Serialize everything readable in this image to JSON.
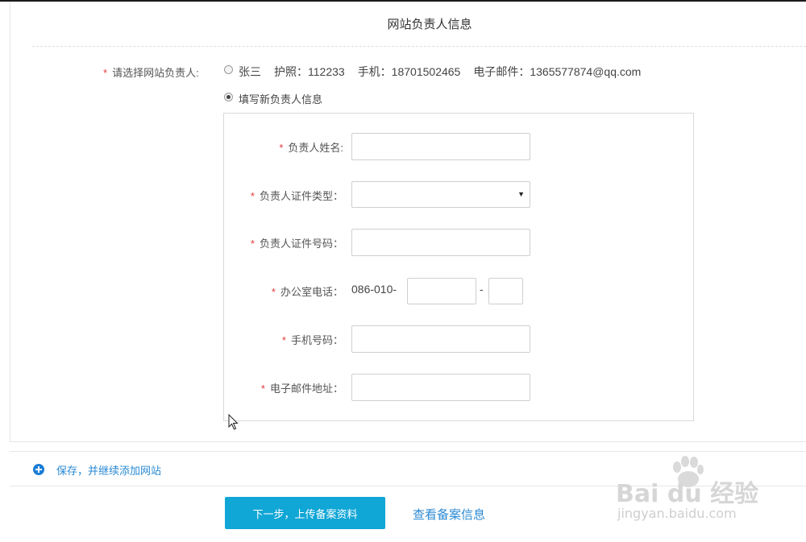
{
  "section": {
    "title": "网站负责人信息"
  },
  "selector": {
    "label": "请选择网站负责人:",
    "existing": {
      "name": "张三",
      "passport": "护照：112233",
      "phone": "手机：18701502465",
      "email": "电子邮件：1365577874@qq.com",
      "selected": false
    },
    "new_option": {
      "label": "填写新负责人信息",
      "selected": true
    }
  },
  "form": {
    "name": {
      "label": "负责人姓名:",
      "value": ""
    },
    "id_type": {
      "label": "负责人证件类型：",
      "value": ""
    },
    "id_number": {
      "label": "负责人证件号码：",
      "value": ""
    },
    "office_phone": {
      "label": "办公室电话：",
      "prefix": "086-010-",
      "separator": "-",
      "number": "",
      "extension": ""
    },
    "mobile": {
      "label": "手机号码：",
      "value": ""
    },
    "email": {
      "label": "电子邮件地址：",
      "value": ""
    }
  },
  "actions": {
    "save_continue": "保存，并继续添加网站",
    "next": "下一步，上传备案资料",
    "view_info": "查看备案信息"
  },
  "icons": {
    "add": "plus-circle-icon",
    "cursor": "mouse-cursor-icon"
  },
  "colors": {
    "required": "#e4393c",
    "primary_button": "#10a6d6",
    "link": "#2a8ad4"
  },
  "watermark": {
    "brand": "Bai du 经验",
    "url": "jingyan.baidu.com"
  }
}
